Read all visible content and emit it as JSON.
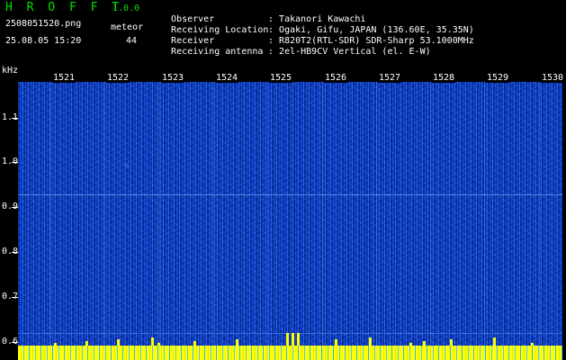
{
  "app": {
    "name": "H R O F F T",
    "version": "1.0.0"
  },
  "file": {
    "name": "2508051520.png",
    "datetime": "25.08.05 15:20"
  },
  "meteor": {
    "label": "meteor",
    "count": "44"
  },
  "meta": [
    {
      "label": "Observer",
      "value": "Takanori Kawachi"
    },
    {
      "label": "Receiving Location",
      "value": "Ogaki, Gifu, JAPAN (136.60E, 35.35N)"
    },
    {
      "label": "Receiver",
      "value": "R820T2(RTL-SDR) SDR-Sharp 53.1000MHz"
    },
    {
      "label": "Receiving antenna",
      "value": "2el-HB9CV Vertical (el. E-W)"
    }
  ],
  "y_axis": {
    "unit": "kHz",
    "ticks": [
      "1.1",
      "1.0",
      "0.9",
      "0.8",
      "0.7",
      "0.6"
    ]
  },
  "x_axis": {
    "ticks": [
      "1521",
      "1522",
      "1523",
      "1524",
      "1525",
      "1526",
      "1527",
      "1528",
      "1529",
      "1530"
    ]
  },
  "colors": {
    "title_green": "#00e000",
    "spectrum_blue": "#1650d8",
    "noise_band": "#ffff00"
  }
}
